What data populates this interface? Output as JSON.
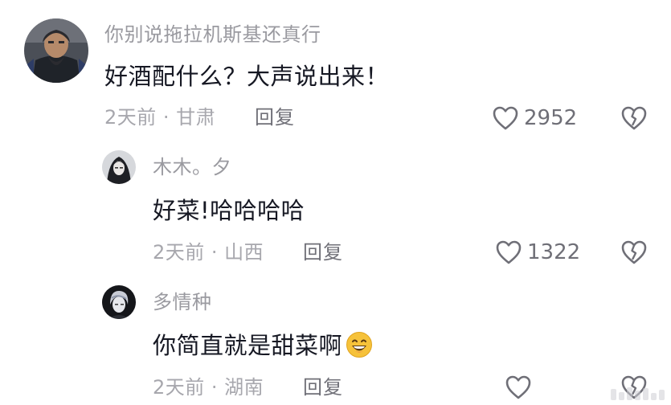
{
  "comments": [
    {
      "username": "你别说拖拉机斯基还真行",
      "content": "好酒配什么？大声说出来！",
      "meta": "2天前 · 甘肃",
      "reply_label": "回复",
      "likes": "2952",
      "avatar_icon": "bearded-man-avatar"
    },
    {
      "username": "木木。夕",
      "content": "好菜!哈哈哈哈",
      "meta": "2天前 · 山西",
      "reply_label": "回复",
      "likes": "1322",
      "avatar_icon": "dark-hooded-avatar"
    },
    {
      "username": "多情种",
      "content": "你简直就是甜菜啊",
      "meta": "2天前 · 湖南",
      "reply_label": "回复",
      "likes": "",
      "avatar_icon": "dark-haired-avatar",
      "emoji": "grinning-face-emoji"
    }
  ],
  "colors": {
    "username": "#9a9aa0",
    "content": "#161823",
    "meta": "#a7a7ad",
    "action": "#6f6f77",
    "emoji_face": "#f6c23a"
  }
}
